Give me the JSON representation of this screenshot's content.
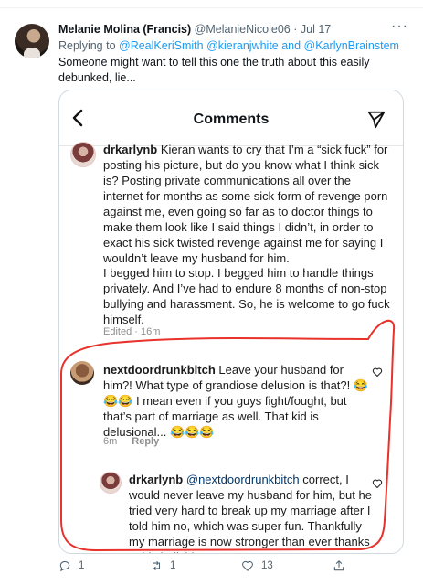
{
  "tweet": {
    "author_name": "Melanie Molina (Francis)",
    "author_handle": "@MelanieNicole06",
    "separator": " · ",
    "date": "Jul 17",
    "more_icon": "more-dots-icon",
    "replying_prefix": "Replying to ",
    "replying_mentions": "@RealKeriSmith @kieranjwhite and @KarlynBrainstem",
    "text": "Someone might want to tell this one the truth about this easily debunked, lie..."
  },
  "media": {
    "title": "Comments",
    "back_icon": "back-chevron-icon",
    "send_icon": "send-paper-plane-icon",
    "comments": [
      {
        "user": "drkarlynb",
        "text": " Kieran wants to cry that I’m a “sick fuck” for posting his picture, but do you know what I think sick is? Posting private communications all over the internet for months as some sick form of revenge porn against me, even going so far as to doctor things to make them look like I said things I didn’t, in order to exact his sick twisted revenge against me for saying I wouldn’t leave my husband for him.",
        "text2": "I begged him to stop. I begged him to handle things privately. And I’ve had to endure 8 months of non-stop bullying and harassment. So, he is welcome to go fuck himself.",
        "meta": "Edited · 16m"
      },
      {
        "user": "nextdoordrunkbitch",
        "text": " Leave your husband for him?! What type of grandiose delusion is that?! 😂😂😂 I mean even if you guys fight/fought, but that’s part of marriage as well. That kid is delusional... 😂😂😂",
        "time": "6m",
        "reply_label": "Reply"
      },
      {
        "user": "drkarlynb",
        "mention": "@nextdoordrunkbitch",
        "text": " correct, I would never leave my husband for him, but he tried very hard to break up my marriage after I told him no, which was super fun. Thankfully my marriage is now stronger than ever thanks to his bullshit."
      }
    ],
    "annotation_color": "#e8322b"
  },
  "actions": {
    "reply_count": "1",
    "retweet_count": "1",
    "like_count": "13",
    "share_icon": "share-upload-icon"
  }
}
